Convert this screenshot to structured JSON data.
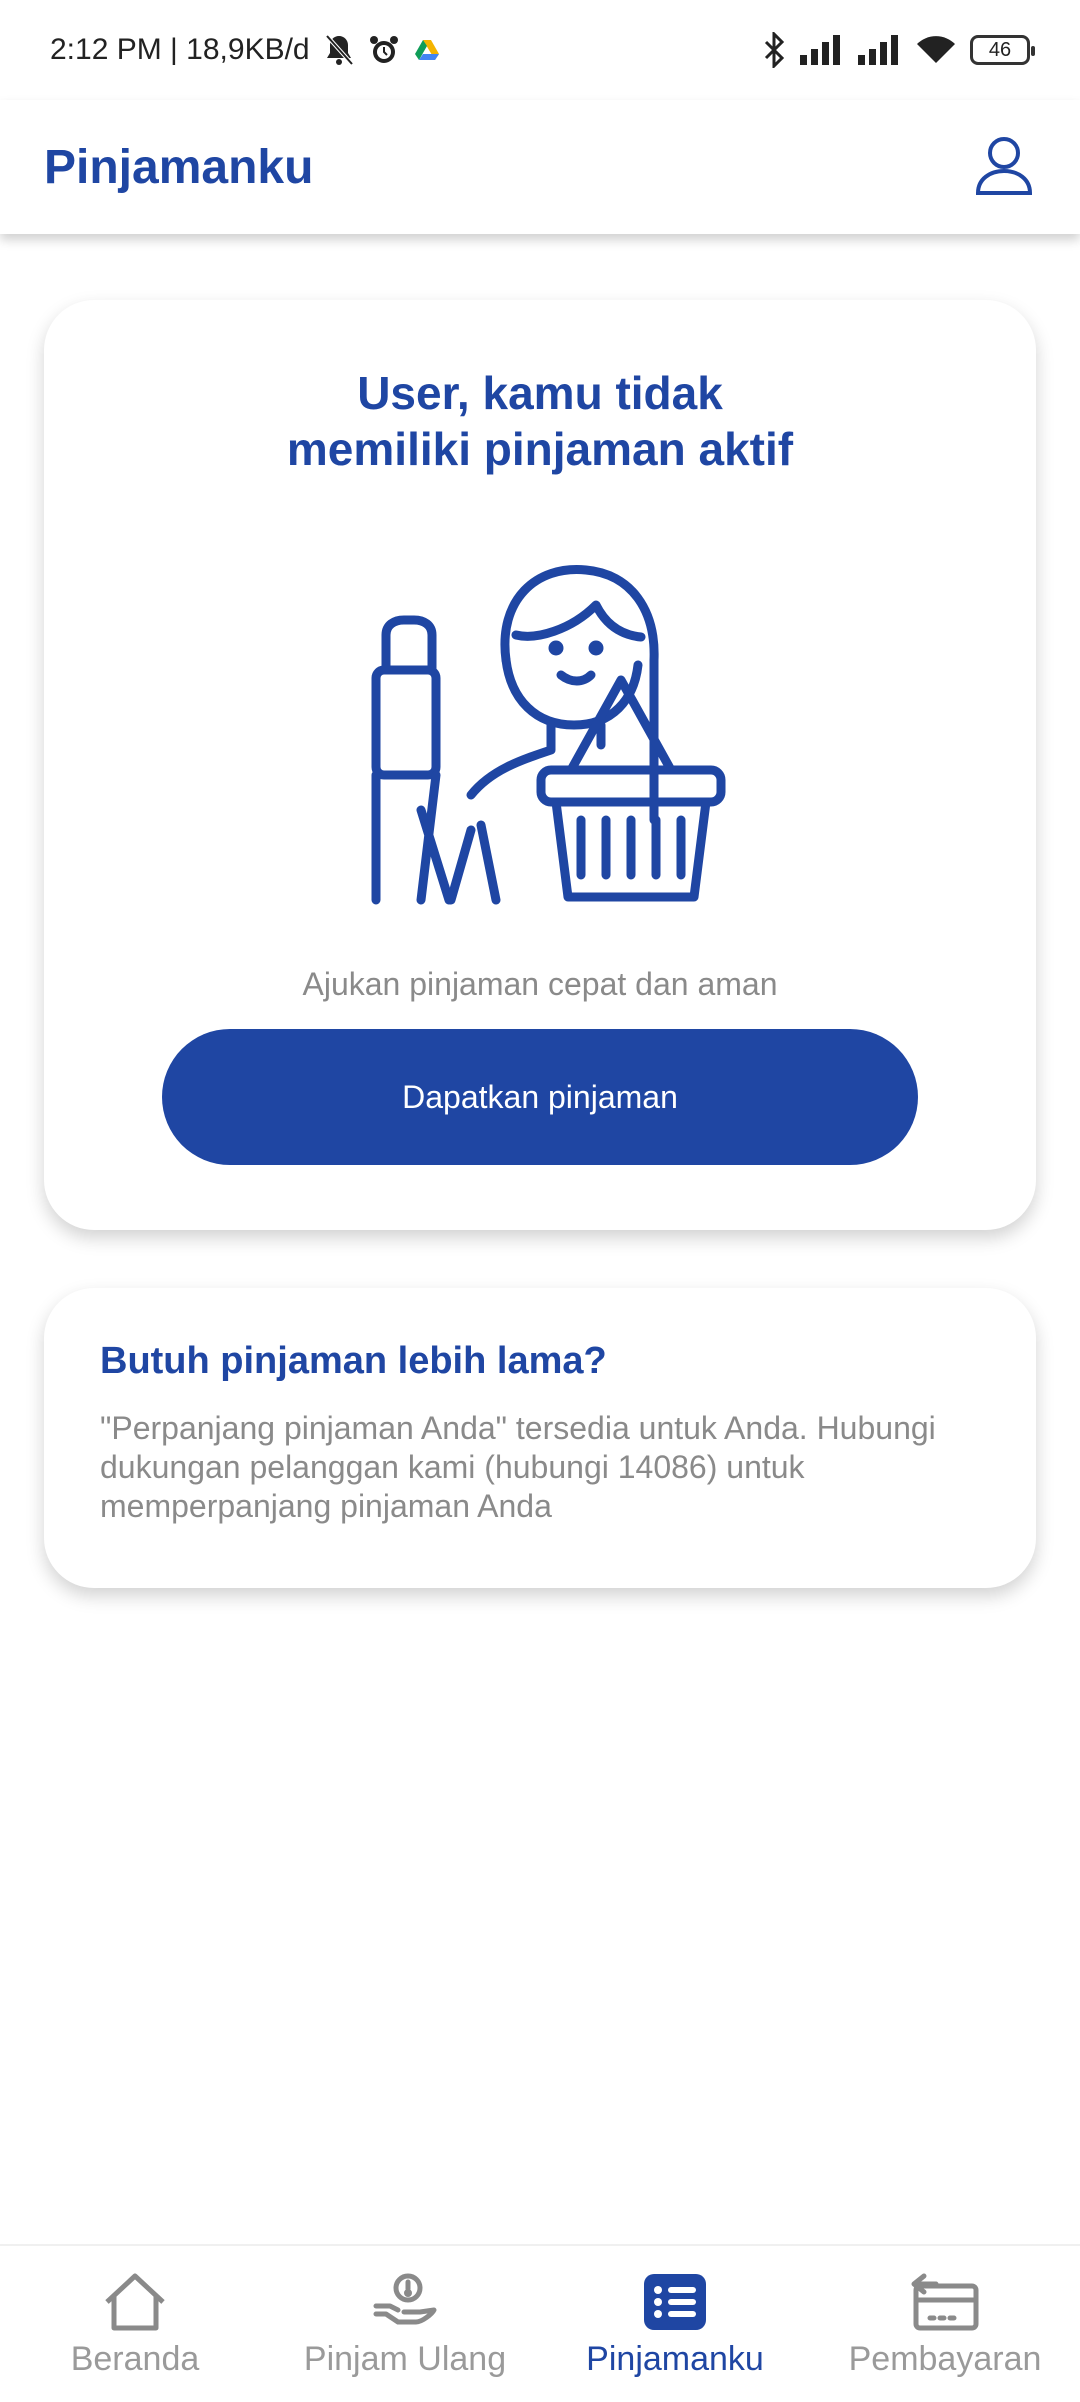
{
  "status_bar": {
    "time_info": "2:12 PM | 18,9KB/d",
    "battery": "46",
    "icons": [
      "mute-bell-icon",
      "alarm-icon",
      "drive-icon",
      "bluetooth-icon",
      "signal-icon",
      "signal-icon",
      "wifi-icon",
      "battery-icon"
    ]
  },
  "app_bar": {
    "title": "Pinjamanku",
    "profile_icon": "user-icon"
  },
  "main_card": {
    "title": "User, kamu tidak\nmemiliki pinjaman aktif",
    "illustration": "woman-shopping-illustration",
    "subtitle": "Ajukan pinjaman cepat dan aman",
    "button_label": "Dapatkan pinjaman"
  },
  "info_card": {
    "title": "Butuh pinjaman lebih lama?",
    "text": "\"Perpanjang pinjaman Anda\" tersedia untuk Anda. Hubungi dukungan pelanggan kami (hubungi 14086) untuk memperpanjang pinjaman Anda"
  },
  "bottom_nav": {
    "items": [
      {
        "label": "Beranda",
        "icon": "home-icon",
        "active": false
      },
      {
        "label": "Pinjam Ulang",
        "icon": "hand-coin-icon",
        "active": false
      },
      {
        "label": "Pinjamanku",
        "icon": "list-icon",
        "active": true
      },
      {
        "label": "Pembayaran",
        "icon": "payment-icon",
        "active": false
      }
    ]
  },
  "colors": {
    "brand": "#1f46a3",
    "muted_text": "#8a8a8a",
    "background": "#ffffff"
  }
}
